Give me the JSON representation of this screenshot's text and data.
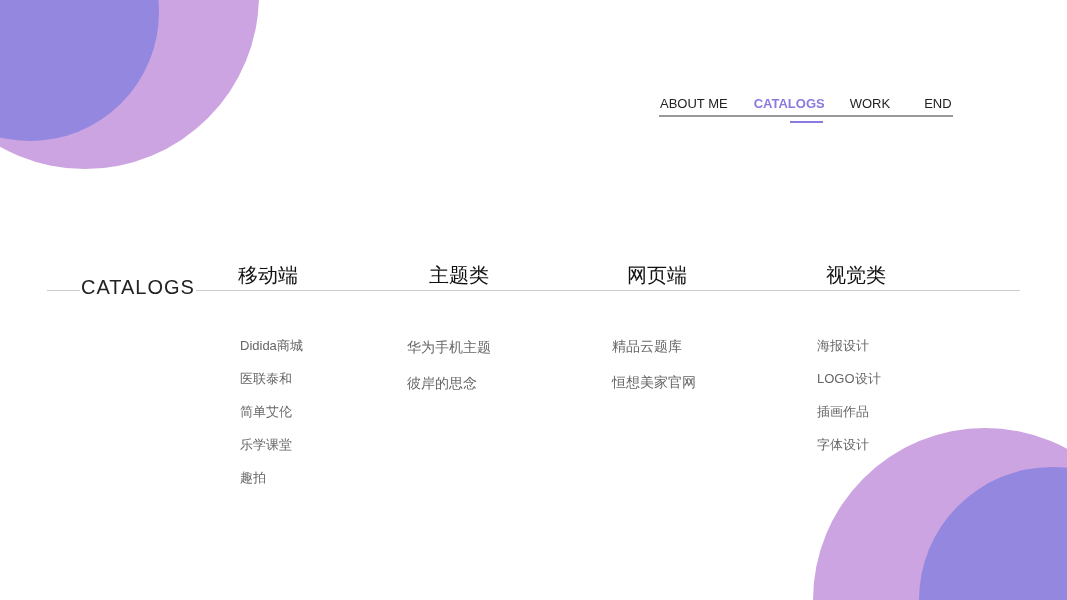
{
  "nav": {
    "items": [
      {
        "label": "ABOUT ME",
        "selected": false
      },
      {
        "label": "CATALOGS",
        "selected": true
      },
      {
        "label": "WORK",
        "selected": false
      },
      {
        "label": "END",
        "selected": false
      }
    ]
  },
  "catalogs": {
    "title": "CATALOGS",
    "columns": [
      {
        "heading": "移动端",
        "items": [
          "Didida商城",
          "医联泰和",
          "简单艾伦",
          "乐学课堂",
          "趣拍"
        ]
      },
      {
        "heading": "主题类",
        "items": [
          "华为手机主题",
          "彼岸的思念"
        ]
      },
      {
        "heading": "网页端",
        "items": [
          "精品云题库",
          "恒想美家官网"
        ]
      },
      {
        "heading": "视觉类",
        "items": [
          "海报设计",
          "LOGO设计",
          "插画作品",
          "字体设计"
        ]
      }
    ]
  }
}
